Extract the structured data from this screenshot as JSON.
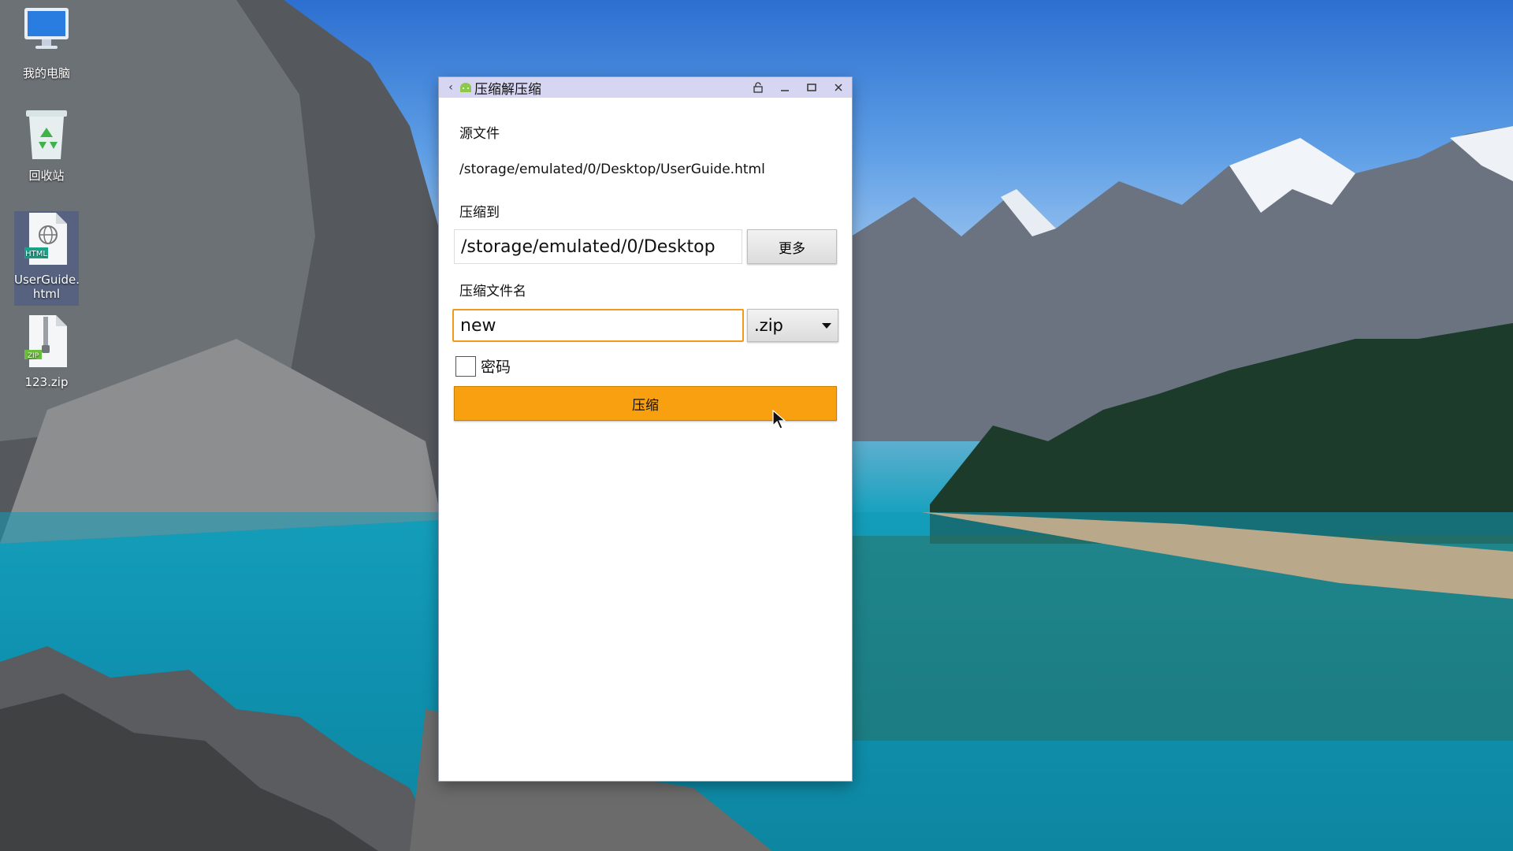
{
  "desktop": {
    "icons": [
      {
        "label": "我的电脑",
        "icon": "computer-icon"
      },
      {
        "label": "回收站",
        "icon": "recycle-bin-icon"
      },
      {
        "label": "UserGuide.\nhtml",
        "badge": "HTML",
        "icon": "html-file-icon"
      },
      {
        "label": "123.zip",
        "badge": "ZIP",
        "icon": "zip-file-icon"
      }
    ]
  },
  "window": {
    "title": "压缩解压缩",
    "buttons": [
      "back-icon",
      "lock-icon",
      "minimize-icon",
      "maximize-icon",
      "close-icon"
    ],
    "source_label": "源文件",
    "source_path": "/storage/emulated/0/Desktop/UserGuide.html",
    "target_label": "压缩到",
    "target_path": "/storage/emulated/0/Desktop",
    "more_label": "更多",
    "name_label": "压缩文件名",
    "name_value": "new",
    "extension": ".zip",
    "password_label": "密码",
    "password_checked": false,
    "compress_label": "压缩"
  },
  "colors": {
    "titlebar": "#d6d6f2",
    "accent_orange": "#f8a010",
    "focus_border": "#f39a1a"
  }
}
